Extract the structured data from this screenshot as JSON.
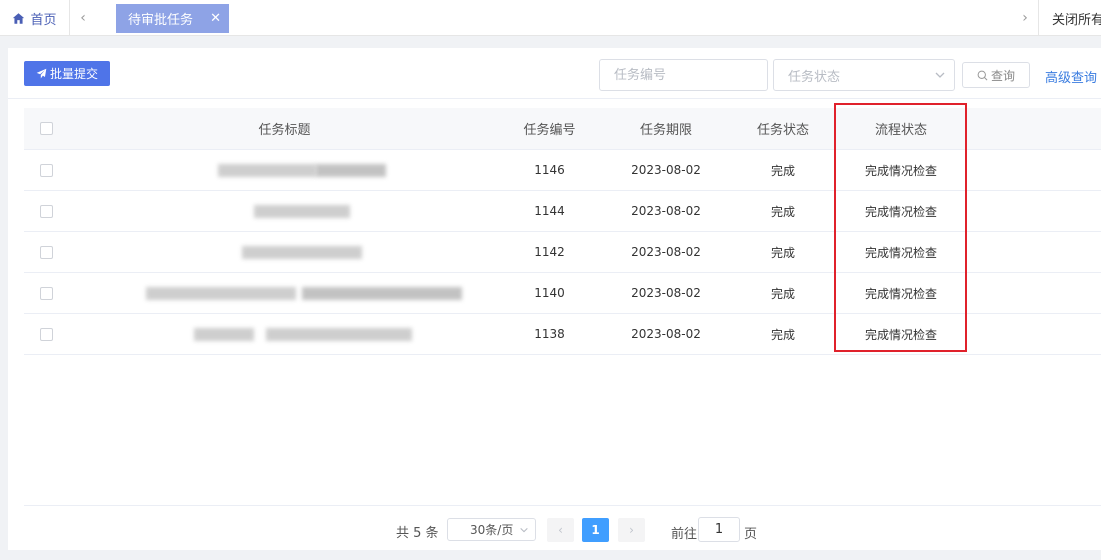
{
  "tabs": {
    "home_label": "首页",
    "active_label": "待审批任务",
    "close_all_label": "关闭所有"
  },
  "toolbar": {
    "batch_submit_label": "批量提交",
    "task_no_placeholder": "任务编号",
    "status_placeholder": "任务状态",
    "query_label": "查询",
    "advanced_label": "高级查询"
  },
  "table": {
    "headers": {
      "title": "任务标题",
      "task_no": "任务编号",
      "deadline": "任务期限",
      "status": "任务状态",
      "flow_status": "流程状态"
    },
    "rows": [
      {
        "task_no": "1146",
        "deadline": "2023-08-02",
        "status": "完成",
        "flow_status": "完成情况检查"
      },
      {
        "task_no": "1144",
        "deadline": "2023-08-02",
        "status": "完成",
        "flow_status": "完成情况检查"
      },
      {
        "task_no": "1142",
        "deadline": "2023-08-02",
        "status": "完成",
        "flow_status": "完成情况检查"
      },
      {
        "task_no": "1140",
        "deadline": "2023-08-02",
        "status": "完成",
        "flow_status": "完成情况检查"
      },
      {
        "task_no": "1138",
        "deadline": "2023-08-02",
        "status": "完成",
        "flow_status": "完成情况检查"
      }
    ]
  },
  "pagination": {
    "total_text": "共 5 条",
    "page_size": "30条/页",
    "current_page": "1",
    "goto_label": "前往",
    "goto_value": "1",
    "page_suffix": "页"
  },
  "colors": {
    "primary": "#4f74e8",
    "active_tab": "#8ea3e6",
    "highlight": "#e0212b",
    "link": "#3b7de0"
  }
}
